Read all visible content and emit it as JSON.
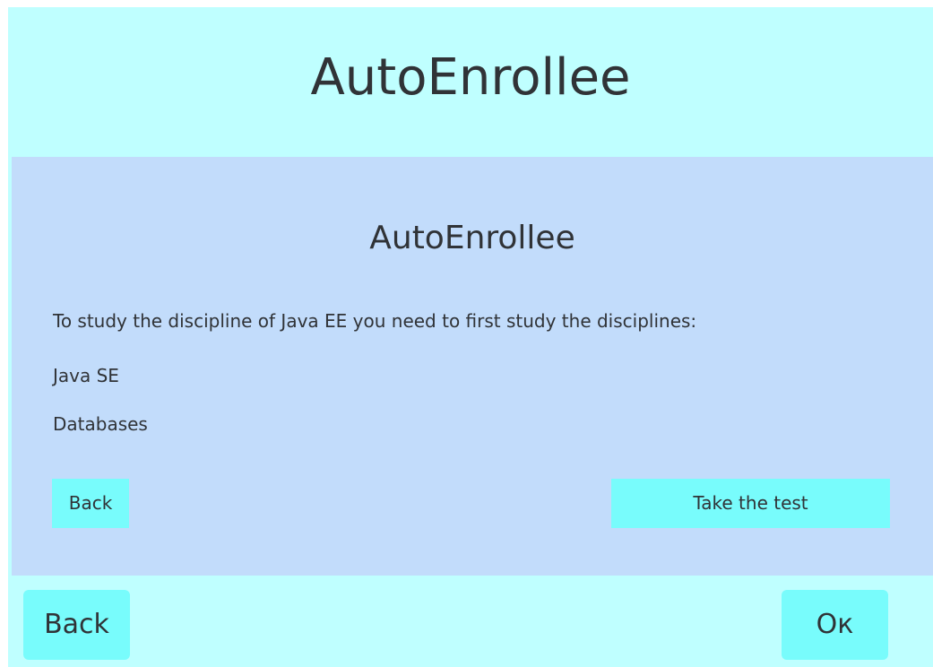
{
  "header": {
    "title": "AutoEnrollee"
  },
  "panel": {
    "title": "AutoEnrollee",
    "message": "To study the discipline of Java EE you need to first study the disciplines:",
    "prerequisites": [
      "Java SE",
      "Databases"
    ],
    "back_label": "Back",
    "take_test_label": "Take the test"
  },
  "footer": {
    "back_label": "Back",
    "ok_label": "Oк"
  },
  "colors": {
    "app_background": "#bfffff",
    "panel_background": "#c2dcfb",
    "button": "#78fcfc",
    "text": "#303337"
  }
}
